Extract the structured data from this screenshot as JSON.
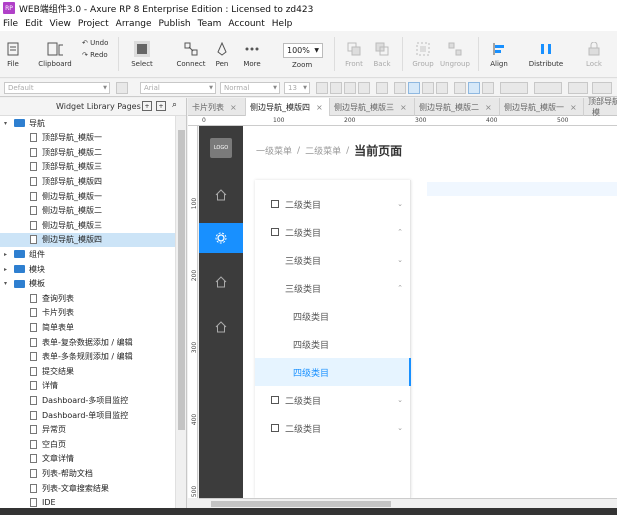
{
  "title": "WEB端组件3.0 - Axure RP 8 Enterprise Edition : Licensed to zd423",
  "app_icon": "RP",
  "menu": [
    "File",
    "Edit",
    "View",
    "Project",
    "Arrange",
    "Publish",
    "Team",
    "Account",
    "Help"
  ],
  "toolbar": {
    "file": "File",
    "clipboard": "Clipboard",
    "undo": "Undo",
    "redo": "Redo",
    "select": "Select",
    "connect": "Connect",
    "pen": "Pen",
    "more": "More",
    "zoom_value": "100%",
    "zoom_label": "Zoom",
    "front": "Front",
    "back": "Back",
    "group": "Group",
    "ungroup": "Ungroup",
    "align": "Align",
    "distribute": "Distribute",
    "lock": "Lock"
  },
  "format": {
    "style": "Default",
    "font": "Arial",
    "weight": "Normal",
    "size": "13"
  },
  "left_panel": {
    "title": "Widget Library Pages",
    "tree": [
      {
        "label": "导航",
        "kind": "folder",
        "level": 0,
        "exp": "▾"
      },
      {
        "label": "顶部导航_模版一",
        "kind": "page",
        "level": 1
      },
      {
        "label": "顶部导航_模版二",
        "kind": "page",
        "level": 1
      },
      {
        "label": "顶部导航_模版三",
        "kind": "page",
        "level": 1
      },
      {
        "label": "顶部导航_模版四",
        "kind": "page",
        "level": 1
      },
      {
        "label": "侧边导航_模版一",
        "kind": "page",
        "level": 1
      },
      {
        "label": "侧边导航_模版二",
        "kind": "page",
        "level": 1
      },
      {
        "label": "侧边导航_模版三",
        "kind": "page",
        "level": 1
      },
      {
        "label": "侧边导航_模版四",
        "kind": "page",
        "level": 1,
        "selected": true
      },
      {
        "label": "组件",
        "kind": "folder",
        "level": 0,
        "exp": "▸"
      },
      {
        "label": "模块",
        "kind": "folder",
        "level": 0,
        "exp": "▸"
      },
      {
        "label": "模板",
        "kind": "folder",
        "level": 0,
        "exp": "▾"
      },
      {
        "label": "查询列表",
        "kind": "page",
        "level": 1
      },
      {
        "label": "卡片列表",
        "kind": "page",
        "level": 1
      },
      {
        "label": "简单表单",
        "kind": "page",
        "level": 1
      },
      {
        "label": "表单-复杂数据添加 / 编辑",
        "kind": "page",
        "level": 1
      },
      {
        "label": "表单-多条规则添加 / 编辑",
        "kind": "page",
        "level": 1
      },
      {
        "label": "提交结果",
        "kind": "page",
        "level": 1
      },
      {
        "label": "详情",
        "kind": "page",
        "level": 1
      },
      {
        "label": "Dashboard-多项目监控",
        "kind": "page",
        "level": 1
      },
      {
        "label": "Dashboard-单项目监控",
        "kind": "page",
        "level": 1
      },
      {
        "label": "异常页",
        "kind": "page",
        "level": 1
      },
      {
        "label": "空白页",
        "kind": "page",
        "level": 1
      },
      {
        "label": "文章详情",
        "kind": "page",
        "level": 1
      },
      {
        "label": "列表-帮助文档",
        "kind": "page",
        "level": 1
      },
      {
        "label": "列表-文章搜索结果",
        "kind": "page",
        "level": 1
      },
      {
        "label": "IDE",
        "kind": "page",
        "level": 1
      }
    ]
  },
  "tabs": [
    {
      "label": "卡片列表",
      "active": false
    },
    {
      "label": "侧边导航_模版四",
      "active": true
    },
    {
      "label": "侧边导航_模版三",
      "active": false
    },
    {
      "label": "侧边导航_模版二",
      "active": false
    },
    {
      "label": "侧边导航_模版一",
      "active": false
    },
    {
      "label": "顶部导航_模",
      "active": false
    }
  ],
  "ruler": {
    "h": [
      "0",
      "100",
      "200",
      "300",
      "400",
      "500"
    ],
    "v": [
      "100",
      "200",
      "300",
      "400",
      "500"
    ]
  },
  "canvas": {
    "logo": "LOGO",
    "breadcrumb": [
      "一级菜单",
      "二级菜单",
      "当前页面"
    ],
    "breadcrumb_sep": "/",
    "menu_items": [
      {
        "label": "二级类目",
        "level": 0,
        "checkbox": true,
        "arrow": "⌄"
      },
      {
        "label": "二级类目",
        "level": 0,
        "checkbox": true,
        "arrow": "⌃"
      },
      {
        "label": "三级类目",
        "level": 1,
        "checkbox": false,
        "arrow": "⌄"
      },
      {
        "label": "三级类目",
        "level": 1,
        "checkbox": false,
        "arrow": "⌃"
      },
      {
        "label": "四级类目",
        "level": 2,
        "checkbox": false,
        "arrow": ""
      },
      {
        "label": "四级类目",
        "level": 2,
        "checkbox": false,
        "arrow": ""
      },
      {
        "label": "四级类目",
        "level": 2,
        "checkbox": false,
        "arrow": "",
        "active": true
      },
      {
        "label": "二级类目",
        "level": 0,
        "checkbox": true,
        "arrow": "⌄"
      },
      {
        "label": "二级类目",
        "level": 0,
        "checkbox": true,
        "arrow": "⌄"
      }
    ],
    "nav_icons": [
      "home-icon",
      "gear-icon",
      "home-icon",
      "home-icon"
    ]
  },
  "colors": {
    "accent": "#1890ff",
    "sidebar": "#3c3c3c",
    "folder": "#2e7fd0"
  }
}
